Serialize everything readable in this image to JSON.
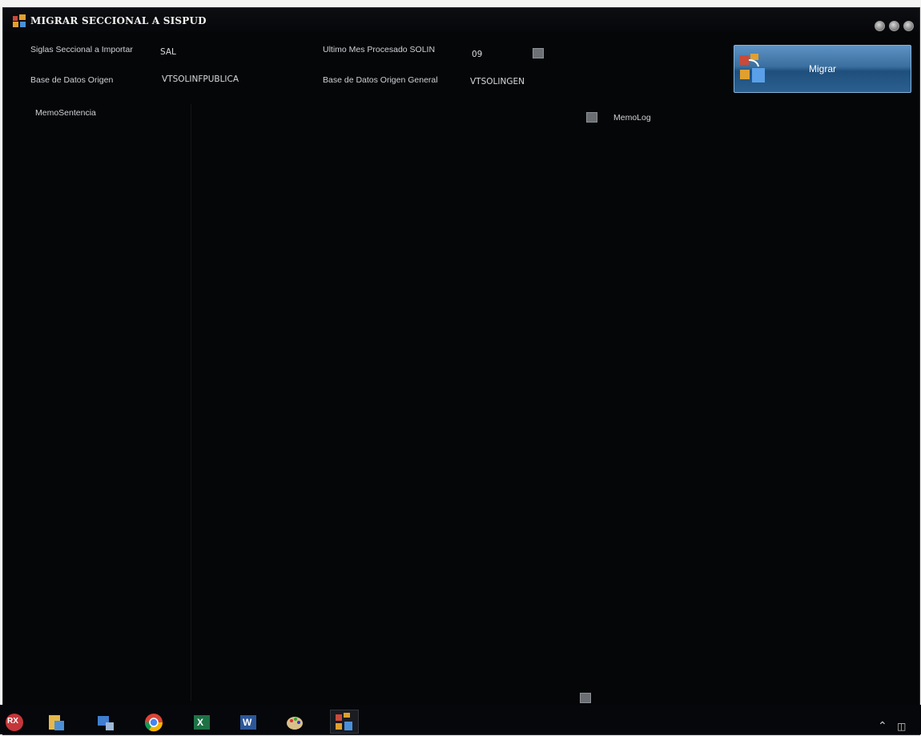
{
  "window": {
    "title": "MIGRAR SECCIONAL A SISPUD"
  },
  "form": {
    "siglas_label": "Siglas Seccional a Importar",
    "siglas_value": "SAL",
    "base_origen_label": "Base de Datos Origen",
    "base_origen_value": "VTSOLINFPUBLICA",
    "ultimo_mes_label": "Ultimo Mes Procesado SOLIN",
    "ultimo_mes_value": "09",
    "base_origen_general_label": "Base de Datos Origen General",
    "base_origen_general_value": "VTSOLINGEN"
  },
  "buttons": {
    "migrar_label": "Migrar"
  },
  "memos": {
    "sentencia_label": "MemoSentencia",
    "log_label": "MemoLog"
  },
  "taskbar": {
    "rx_label": "RX",
    "excel_label": "X",
    "word_label": "W"
  },
  "colors": {
    "window_bg": "#050608",
    "button_blue": "#3a6f9f",
    "text": "#cfd2d6"
  }
}
